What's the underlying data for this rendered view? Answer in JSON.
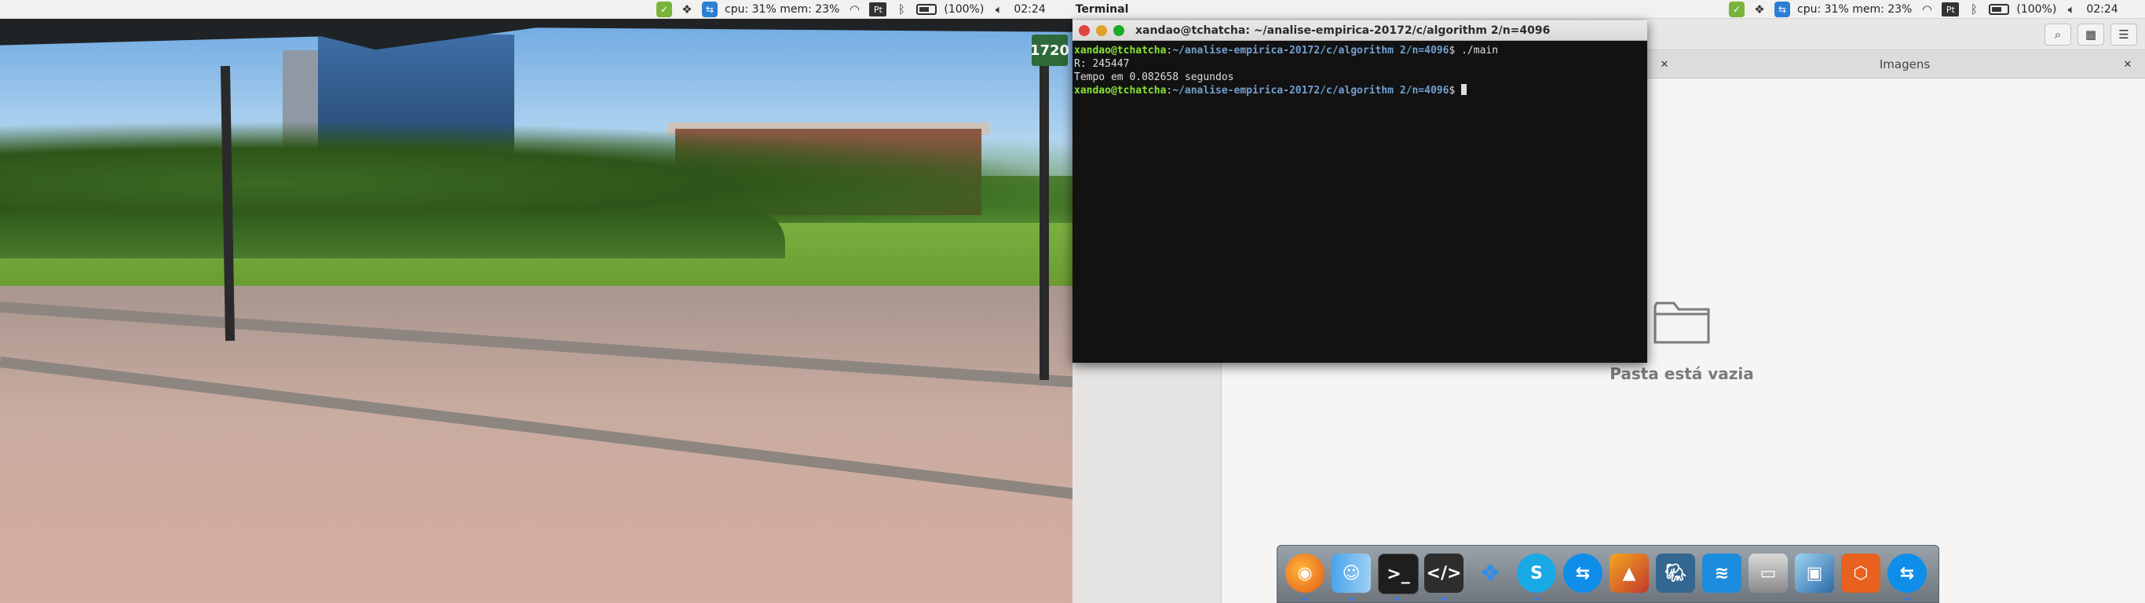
{
  "topbar": {
    "sysmon": "cpu: 31% mem: 23%",
    "keyboard": "Pt",
    "battery": "(100%)",
    "clock": "02:24",
    "active_app": "Terminal"
  },
  "terminal": {
    "title": "xandao@tchatcha: ~/analise-empirica-20172/c/algorithm 2/n=4096",
    "user_host": "xandao@tchatcha",
    "path": "~/analise-empirica-20172/c/algorithm 2/n=4096",
    "prompt_suffix": "$",
    "command": "./main",
    "output_lines": [
      "R: 245447",
      "Tempo em 0.082658 segundos"
    ]
  },
  "photo": {
    "sign_text": "1720"
  },
  "file_manager": {
    "tab_label": "Imagens",
    "empty_message": "Pasta está vazia"
  },
  "dock": {
    "apps": [
      "firefox",
      "finder",
      "terminal",
      "code-editor",
      "dropbox",
      "skype",
      "teamviewer",
      "matlab",
      "postgresql",
      "mysql-workbench",
      "scanner",
      "virtualbox",
      "package-manager",
      "teamviewer-2"
    ]
  },
  "colors": {
    "terminal_bg": "#121212",
    "terminal_user": "#8ae234",
    "terminal_path": "#729fcf"
  }
}
